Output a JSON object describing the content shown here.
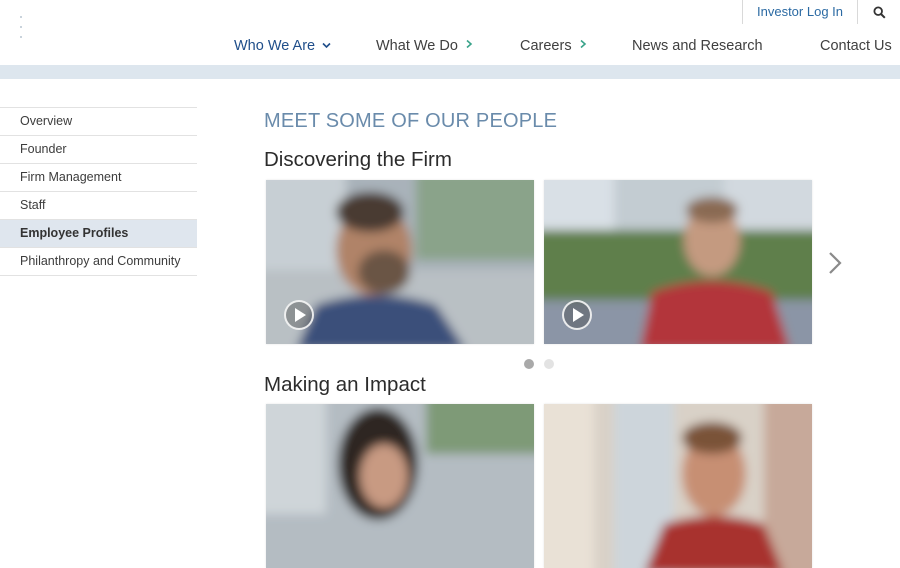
{
  "header": {
    "investor_login": "Investor Log In",
    "search_icon": "search-icon"
  },
  "nav": {
    "items": [
      {
        "label": "Who We Are",
        "icon": "chevron-down-icon",
        "active": true
      },
      {
        "label": "What We Do",
        "icon": "chevron-right-icon"
      },
      {
        "label": "Careers",
        "icon": "chevron-right-icon"
      },
      {
        "label": "News and Research"
      },
      {
        "label": "Contact Us"
      }
    ]
  },
  "sidebar": {
    "items": [
      {
        "label": "Overview"
      },
      {
        "label": "Founder"
      },
      {
        "label": "Firm Management"
      },
      {
        "label": "Staff"
      },
      {
        "label": "Employee Profiles",
        "active": true
      },
      {
        "label": "Philanthropy and Community"
      }
    ]
  },
  "main": {
    "eyebrow": "MEET SOME OF OUR PEOPLE",
    "sections": [
      {
        "title": "Discovering the Firm",
        "videos": [
          "play-icon",
          "play-icon"
        ]
      },
      {
        "title": "Making an Impact",
        "videos": []
      }
    ],
    "carousel": {
      "pages": 2,
      "current": 1
    }
  },
  "colors": {
    "accent": "#1f4e8a",
    "link": "#2b6aa3",
    "eyebrow": "#6a8bab",
    "band": "#dde6ee",
    "sidebar_active": "#dfe6ee"
  }
}
